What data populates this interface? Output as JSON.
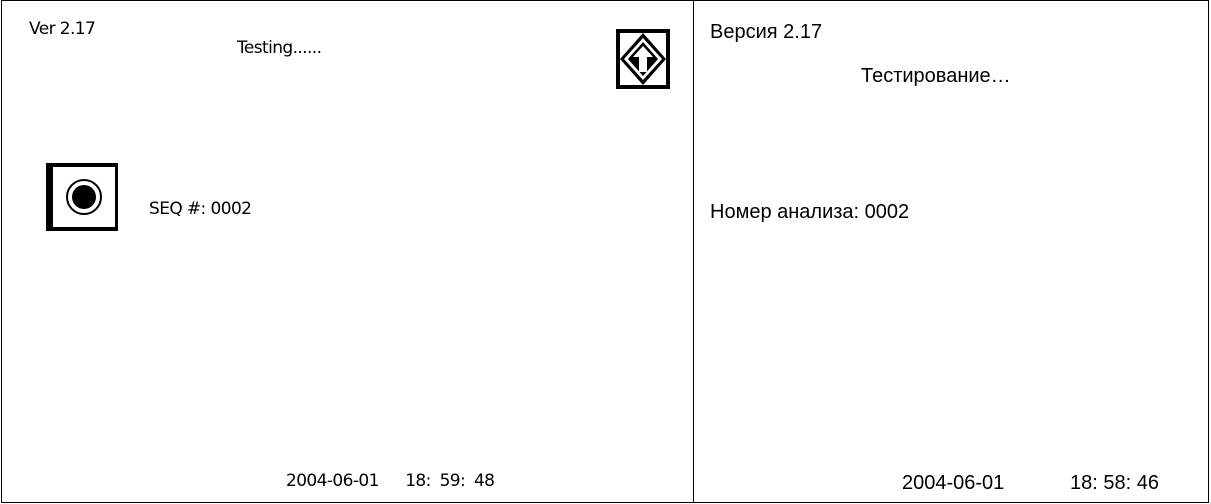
{
  "device_screen": {
    "version": "Ver 2.17",
    "status": "Testing......",
    "seq_label": "SEQ #:",
    "seq_value": "0002",
    "date": "2004-06-01",
    "time": "18: 59: 48",
    "nav_icon": "arrow-up-diamond-icon",
    "record_icon": "record-circle-icon"
  },
  "translation": {
    "version": "Версия 2.17",
    "status": "Тестирование…",
    "seq_label": "Номер анализа: 0002",
    "date": "2004-06-01",
    "time": "18: 58: 46"
  }
}
